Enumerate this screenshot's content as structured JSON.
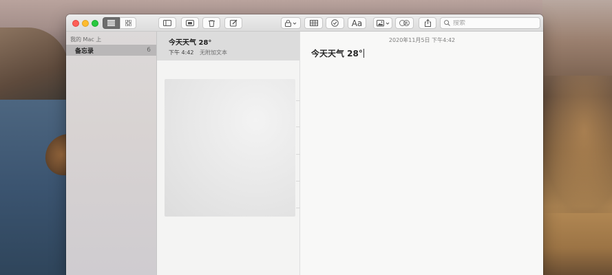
{
  "window": {
    "title_controls": [
      "close",
      "minimize",
      "zoom"
    ]
  },
  "toolbar": {
    "view_list_icon": "list-view-icon",
    "view_gallery_icon": "gallery-view-icon",
    "sidebar_icon": "sidebar-toggle-icon",
    "attachments_icon": "attachments-icon",
    "delete_icon": "trash-icon",
    "compose_icon": "compose-icon",
    "lock_icon": "lock-icon",
    "table_icon": "table-icon",
    "checklist_icon": "checklist-icon",
    "format_label": "Aa",
    "media_icon": "photo-icon",
    "collaborate_icon": "add-people-icon",
    "share_icon": "share-icon",
    "search_placeholder": "搜索"
  },
  "sidebar": {
    "section_label": "我的 Mac 上",
    "folders": [
      {
        "label": "备忘录",
        "count": "6"
      }
    ]
  },
  "note_list": {
    "items": [
      {
        "title": "今天天气 28°",
        "time": "下午 4:42",
        "preview": "无附加文本"
      }
    ]
  },
  "editor": {
    "date": "2020年11月5日 下午4:42",
    "body": "今天天气 28°"
  },
  "colors": {
    "close": "#fd5f57",
    "minimize": "#febc2e",
    "zoom": "#28c840",
    "selected_row": "#dcdcdc",
    "sidebar_selected": "#b9b7b8"
  }
}
